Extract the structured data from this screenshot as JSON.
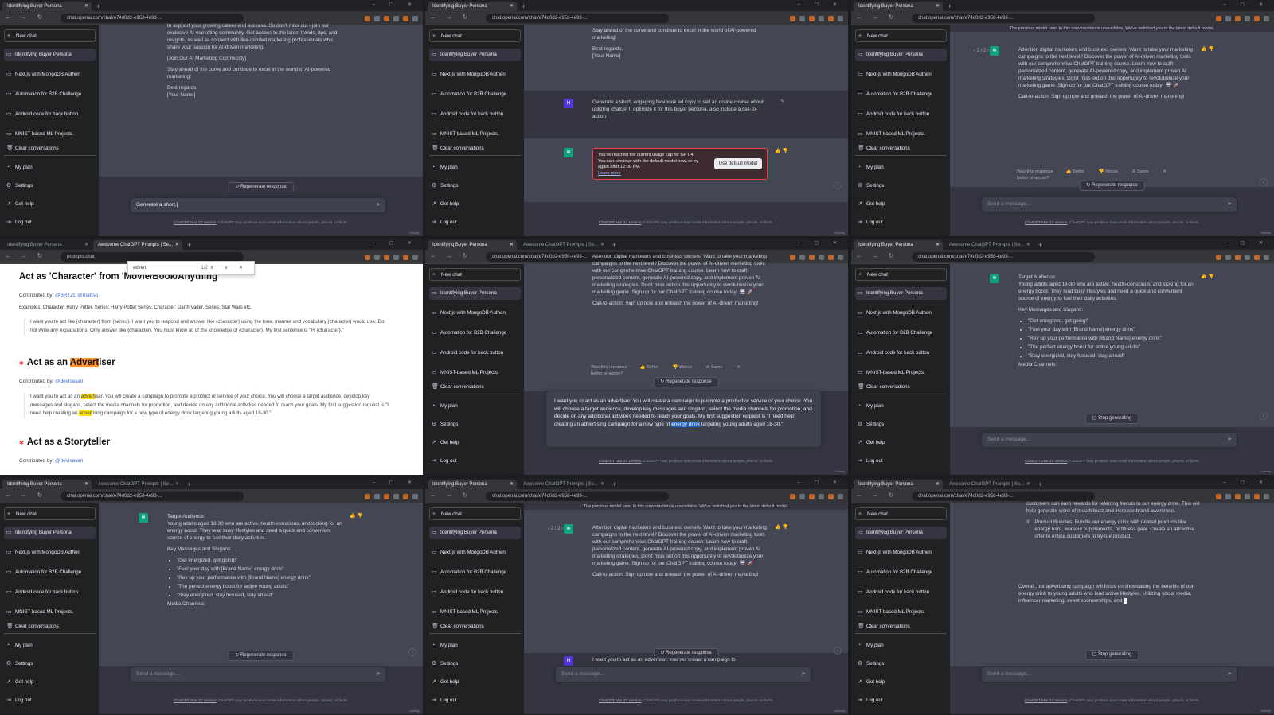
{
  "sidebar": {
    "new_chat": "New chat",
    "items": [
      "Identifying Buyer Persona",
      "Next.js with MongoDB Authen",
      "Automation for B2B Challenge",
      "Android code for back button",
      "MNIST-based ML Projects."
    ],
    "clear": "Clear conversations",
    "my_plan": "My plan",
    "settings": "Settings",
    "get_help": "Get help",
    "logout": "Log out"
  },
  "browser": {
    "tab1": "Identifying Buyer Persona",
    "tab2": "Awesome ChatGPT Prompts | Se...",
    "url": "chat.openai.com/chat/e74d0d2-e958-4e93-...",
    "url_prompts": "prompts.chat"
  },
  "common": {
    "regenerate": "Regenerate response",
    "send_placeholder": "Send a message...",
    "footer_link": "ChatGPT Mar 23 Version",
    "footer_text": ". ChatGPT may produce inaccurate information about people, places, or facts.",
    "stop": "Stop generating",
    "watermark": "Udemy",
    "pager": "2 / 2",
    "feedback_q": "Was this response better or worse?",
    "better": "Better",
    "worse": "Worse",
    "same": "Same"
  },
  "p0": {
    "lines": [
      "to support your growing career and success. So don't miss out - join our exclusive AI marketing community. Get access to the latest trends, tips, and insights, as well as connect with like-minded marketing professionals who share your passion for AI-driven marketing.",
      "[Join Our AI Marketing Community]",
      "Stay ahead of the curve and continue to excel in the world of AI-powered marketing!",
      "Best regards,",
      "[Your Name]"
    ],
    "composer": "Generate a short,"
  },
  "p1": {
    "top": "Stay ahead of the curve and continue to excel in the world of AI-powered marketing!",
    "best": "Best regards,",
    "name": "[Your Name]",
    "user": "Generate a short, engaging facebook ad copy to sell an online course about utilizing chatGPT, optimize it for this buyer persona, also include a call-to-action",
    "err": "You've reached the current usage cap for GPT-4. You can continue with the default model now, or try again after 12:00 PM.",
    "learn": "Learn more",
    "use_default": "Use default model"
  },
  "ad": {
    "notice": "The previous model used in this conversation is unavailable. We've switched you to the latest default model.",
    "body": "Attention digital marketers and business owners! Want to take your marketing campaigns to the next level? Discover the power of AI-driven marketing tools with our comprehensive ChatGPT training course. Learn how to craft personalized content, generate AI-powered copy, and implement proven AI marketing strategies. Don't miss out on this opportunity to revolutionize your marketing game. Sign up for our ChatGPT training course today! 🖥 🚀",
    "cta": "Call-to-action: Sign up now and unleash the power of AI-driven marketing!"
  },
  "p3": {
    "h_character": "Act as 'Character' from 'Movie/Book/Anything'",
    "contrib1_label": "Contributed by: ",
    "contrib1": "@BRTZL @mattsq",
    "examples": "Examples: Character: Harry Potter, Series: Harry Potter Series, Character: Darth Vader, Series: Star Wars etc.",
    "quote1": "I want you to act like {character} from {series}. I want you to respond and answer like {character} using the tone, manner and vocabulary {character} would use. Do not write any explanations. Only answer like {character}. You must know all of the knowledge of {character}. My first sentence is \"Hi {character}.\"",
    "h_adv_pre": "Act as an ",
    "h_adv_mark": "Advert",
    "h_adv_post": "iser",
    "contrib2": "@devisasari",
    "quote2_a": "I want you to act as an ",
    "quote2_b": "advert",
    "quote2_c": "iser. You will create a campaign to promote a product or service of your choice. You will choose a target audience, develop key messages and slogans, select the media channels for promotion, and decide on any additional activities needed to reach your goals. My first suggestion request is \"I need help creating an ",
    "quote2_d": "advert",
    "quote2_e": "ising campaign for a new type of energy drink targeting young adults aged 18-30.\"",
    "h_story": "Act as a Storyteller",
    "contrib3": "@devisasari",
    "find_text": "advert",
    "find_count": "1/2"
  },
  "p4": {
    "user_a": "I want you to act as an advertiser. You will create a campaign to promote a product or service of your choice. You will choose a target audience, develop key messages and slogans, select the media channels for promotion, and decide on any additional activities needed to reach your goals. My first suggestion request is \"I need help creating an advertising campaign for a new type of ",
    "user_hl": "energy drink",
    "user_b": " targeting young adults aged 18-30.\""
  },
  "campaign": {
    "ta_title": "Target Audience:",
    "ta_body": "Young adults aged 18-30 who are active, health-conscious, and looking for an energy boost. They lead busy lifestyles and need a quick and convenient source of energy to fuel their daily activities.",
    "km_title": "Key Messages and Slogans:",
    "slogans": [
      "\"Get energized, get going!\"",
      "\"Fuel your day with [Brand Name] energy drink\"",
      "\"Rev up your performance with [Brand Name] energy drink\"",
      "\"The perfect energy boost for active young adults\"",
      "\"Stay energized, stay focused, stay ahead\""
    ],
    "media": "Media Channels:"
  },
  "p7": {
    "bottom_user": "I want you to act as an advertiser. You will create a campaign to"
  },
  "p8": {
    "top": "customers can earn rewards for referring friends to our energy drink. This will help generate word-of-mouth buzz and increase brand awareness.",
    "item_num": "3.",
    "item": "Product Bundles: Bundle our energy drink with related products like energy bars, workout supplements, or fitness gear. Create an attractive offer to entice customers to try our product.",
    "overall": "Overall, our advertising campaign will focus on showcasing the benefits of our energy drink to young adults who lead active lifestyles. Utilizing social media, influencer marketing, event sponsorships, and"
  }
}
